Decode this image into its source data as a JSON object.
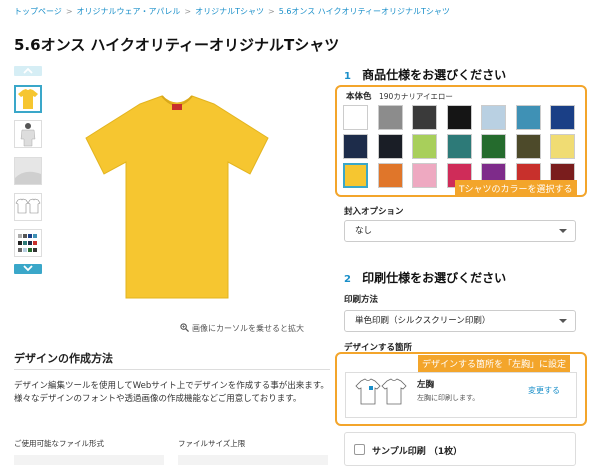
{
  "breadcrumb": [
    "トップページ",
    "オリジナルウェア・アパレル",
    "オリジナルTシャツ",
    "5.6オンス ハイクオリティーオリジナルTシャツ"
  ],
  "page_title": "5.6オンス ハイクオリティーオリジナルTシャツ",
  "zoom_note": "画像にカーソルを乗せると拡大",
  "product_color": "#f6c630",
  "design_section": {
    "heading": "デザインの作成方法",
    "description": "デザイン編集ツールを使用してWebサイト上でデザインを作成する事が出来ます。様々なデザインのフォントや透過画像の作成機能などご用意しております。",
    "format_label": "ご使用可能なファイル形式",
    "size_label": "ファイルサイズ上限"
  },
  "step1": {
    "num": "1",
    "heading": "商品仕様をお選びください",
    "body_color_label": "本体色",
    "body_color_value": "190カナリアイエロー",
    "badge": "Tシャツのカラーを選択する",
    "swatches": [
      "#ffffff",
      "#8c8c8c",
      "#3a3a3a",
      "#151515",
      "#b9d0e2",
      "#3f91b5",
      "#1a3f86",
      "#1d2c4a",
      "#1a1e26",
      "#a8cf5b",
      "#2d7a78",
      "#256b2d",
      "#4d4a2a",
      "#f0dc73",
      "#f6c630",
      "#e0762a",
      "#eea9c1",
      "#cf2c59",
      "#7e2b8a",
      "#c8302c",
      "#7a1d1d"
    ],
    "selected_index": 14,
    "option_label": "封入オプション",
    "option_value": "なし"
  },
  "step2": {
    "num": "2",
    "heading": "印刷仕様をお選びください",
    "method_label": "印刷方法",
    "method_value": "単色印刷（シルクスクリーン印刷）",
    "place_label": "デザインする箇所",
    "badge": "デザインする箇所を「左胸」に設定",
    "place_name": "左胸",
    "place_desc": "左胸に印刷します。",
    "place_change": "変更する",
    "sample_label": "サンプル印刷 （1枚）"
  }
}
